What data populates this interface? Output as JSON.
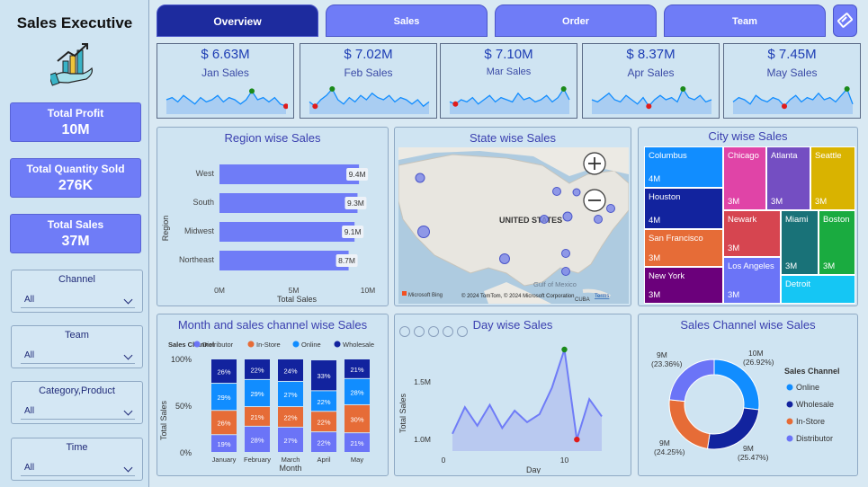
{
  "app_title": "Sales Executive",
  "kpis": [
    {
      "label": "Total Profit",
      "value": "10M"
    },
    {
      "label": "Total Quantity Sold",
      "value": "276K"
    },
    {
      "label": "Total Sales",
      "value": "37M"
    }
  ],
  "slicers": [
    {
      "label": "Channel",
      "value": "All"
    },
    {
      "label": "Team",
      "value": "All"
    },
    {
      "label": "Category,Product",
      "value": "All"
    },
    {
      "label": "Time",
      "value": "All"
    }
  ],
  "tabs": [
    "Overview",
    "Sales",
    "Order",
    "Team"
  ],
  "active_tab": "Overview",
  "month_cards": [
    {
      "value": "$ 6.63M",
      "label": "Jan Sales"
    },
    {
      "value": "$ 7.02M",
      "label": "Feb Sales"
    },
    {
      "value": "$ 7.10M",
      "label": "Mar Sales"
    },
    {
      "value": "$ 8.37M",
      "label": "Apr Sales"
    },
    {
      "value": "$ 7.45M",
      "label": "May Sales"
    }
  ],
  "region": {
    "title": "Region wise Sales",
    "ylabel": "Region",
    "xlabel": "Total Sales",
    "ticks": [
      "0M",
      "5M",
      "10M"
    ],
    "bars": [
      {
        "name": "West",
        "value": 9.4,
        "label": "9.4M"
      },
      {
        "name": "South",
        "value": 9.3,
        "label": "9.3M"
      },
      {
        "name": "Midwest",
        "value": 9.1,
        "label": "9.1M"
      },
      {
        "name": "Northeast",
        "value": 8.7,
        "label": "8.7M"
      }
    ],
    "max": 10
  },
  "state_map": {
    "title": "State wise Sales",
    "country_label": "UNITED STATES",
    "gulf_label": "Gulf of Mexico",
    "cuba_label": "CUBA",
    "copyright": "© 2024 TomTom, © 2024 Microsoft Corporation",
    "terms": "Terms",
    "bing": "Microsoft Bing"
  },
  "city": {
    "title": "City wise Sales",
    "cells": [
      {
        "name": "Columbus",
        "value": "4M",
        "color": "#118dff"
      },
      {
        "name": "Houston",
        "value": "4M",
        "color": "#12239e"
      },
      {
        "name": "San Francisco",
        "value": "3M",
        "color": "#e66c37"
      },
      {
        "name": "New York",
        "value": "3M",
        "color": "#6b007b"
      },
      {
        "name": "Chicago",
        "value": "3M",
        "color": "#e044a7"
      },
      {
        "name": "Atlanta",
        "value": "3M",
        "color": "#744ec2"
      },
      {
        "name": "Seattle",
        "value": "3M",
        "color": "#d9b300"
      },
      {
        "name": "Newark",
        "value": "3M",
        "color": "#d64550"
      },
      {
        "name": "Miami",
        "value": "3M",
        "color": "#197278"
      },
      {
        "name": "Boston",
        "value": "3M",
        "color": "#1aab40"
      },
      {
        "name": "Los Angeles",
        "value": "3M",
        "color": "#6b74f7"
      },
      {
        "name": "Detroit",
        "value": "",
        "color": "#15c6f4"
      }
    ]
  },
  "month_channel": {
    "title": "Month and sales channel wise Sales",
    "legend_title": "Sales Channel",
    "xlabel": "Month",
    "ylabel": "Total Sales",
    "yticks": [
      "100%",
      "50%",
      "0%"
    ]
  },
  "day_sales": {
    "title": "Day wise Sales",
    "xlabel": "Day",
    "ylabel": "Total Sales",
    "xticks": [
      "0",
      "10"
    ],
    "yticks": [
      "1.5M",
      "1.0M"
    ]
  },
  "channel_donut": {
    "title": "Sales Channel wise Sales",
    "legend_title": "Sales Channel"
  },
  "chart_data": [
    {
      "type": "bar",
      "title": "Region wise Sales",
      "categories": [
        "West",
        "South",
        "Midwest",
        "Northeast"
      ],
      "values": [
        9.4,
        9.3,
        9.1,
        8.7
      ],
      "xlabel": "Total Sales",
      "ylabel": "Region",
      "xlim": [
        0,
        10
      ]
    },
    {
      "type": "bar",
      "title": "Month and sales channel wise Sales",
      "stacked": "percent",
      "categories": [
        "January",
        "February",
        "March",
        "April",
        "May"
      ],
      "series": [
        {
          "name": "Distributor",
          "color": "#6b74f7",
          "values": [
            19,
            28,
            27,
            22,
            21
          ]
        },
        {
          "name": "In-Store",
          "color": "#e66c37",
          "values": [
            26,
            21,
            22,
            22,
            30
          ]
        },
        {
          "name": "Online",
          "color": "#118dff",
          "values": [
            29,
            29,
            27,
            22,
            28
          ]
        },
        {
          "name": "Wholesale",
          "color": "#12239e",
          "values": [
            26,
            22,
            24,
            33,
            21
          ]
        }
      ],
      "xlabel": "Month",
      "ylabel": "Total Sales",
      "ylim": [
        0,
        100
      ]
    },
    {
      "type": "area",
      "title": "Day wise Sales",
      "x": [
        1,
        2,
        3,
        4,
        5,
        6,
        7,
        8,
        9,
        10,
        11,
        12,
        13
      ],
      "values": [
        1.05,
        1.28,
        1.12,
        1.3,
        1.1,
        1.25,
        1.15,
        1.22,
        1.45,
        1.78,
        1.0,
        1.35,
        1.2
      ],
      "max_point": {
        "x": 10,
        "y": 1.78
      },
      "min_point": {
        "x": 11,
        "y": 1.0
      },
      "xlabel": "Day",
      "ylabel": "Total Sales",
      "ylim": [
        0.9,
        1.85
      ]
    },
    {
      "type": "pie",
      "title": "Sales Channel wise Sales",
      "donut": true,
      "slices": [
        {
          "name": "Online",
          "value": 26.92,
          "label": "10M",
          "pct": "(26.92%)",
          "color": "#118dff"
        },
        {
          "name": "Wholesale",
          "value": 25.47,
          "label": "9M",
          "pct": "(25.47%)",
          "color": "#12239e"
        },
        {
          "name": "In-Store",
          "value": 24.25,
          "label": "9M",
          "pct": "(24.25%)",
          "color": "#e66c37"
        },
        {
          "name": "Distributor",
          "value": 23.36,
          "label": "9M",
          "pct": "(23.36%)",
          "color": "#6b74f7"
        }
      ]
    },
    {
      "type": "line",
      "title": "Monthly sparklines",
      "series": [
        {
          "values": [
            0.5,
            0.6,
            0.4,
            0.7,
            0.5,
            0.3,
            0.6,
            0.4,
            0.5,
            0.7,
            0.4,
            0.6,
            0.5,
            0.3,
            0.5,
            0.9,
            0.5,
            0.6,
            0.4,
            0.6,
            0.3,
            0.2
          ]
        },
        {
          "values": [
            0.4,
            0.2,
            0.5,
            0.7,
            1.0,
            0.5,
            0.3,
            0.6,
            0.4,
            0.7,
            0.5,
            0.8,
            0.6,
            0.5,
            0.7,
            0.4,
            0.6,
            0.5,
            0.3,
            0.5,
            0.2,
            0.4
          ]
        },
        {
          "values": [
            0.4,
            0.3,
            0.5,
            0.4,
            0.6,
            0.3,
            0.5,
            0.7,
            0.4,
            0.6,
            0.5,
            0.4,
            0.8,
            0.5,
            0.6,
            0.4,
            0.5,
            0.7,
            0.4,
            0.6,
            1.0,
            0.5
          ]
        },
        {
          "values": [
            0.5,
            0.4,
            0.6,
            0.8,
            0.5,
            0.4,
            0.7,
            0.5,
            0.3,
            0.6,
            0.2,
            0.5,
            0.7,
            0.5,
            0.6,
            0.4,
            1.0,
            0.6,
            0.5,
            0.7,
            0.4,
            0.5
          ]
        },
        {
          "values": [
            0.4,
            0.6,
            0.5,
            0.3,
            0.7,
            0.5,
            0.4,
            0.6,
            0.5,
            0.2,
            0.5,
            0.7,
            0.4,
            0.6,
            0.5,
            0.8,
            0.5,
            0.6,
            0.4,
            0.7,
            1.0,
            0.3
          ]
        }
      ]
    }
  ]
}
